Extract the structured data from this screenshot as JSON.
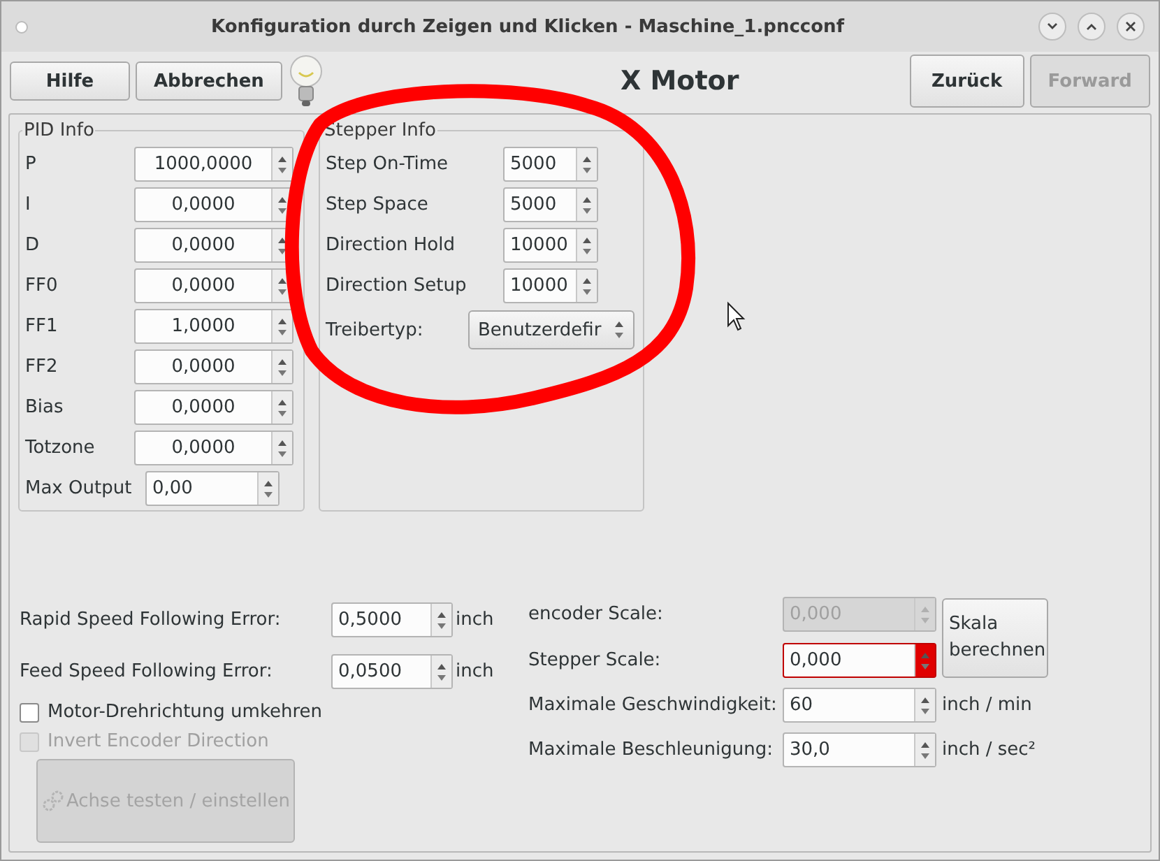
{
  "window": {
    "title": "Konfiguration durch Zeigen und Klicken - Maschine_1.pncconf"
  },
  "toolbar": {
    "buttons": [
      {
        "label": "Hilfe",
        "disabled": false
      },
      {
        "label": "Abbrechen",
        "disabled": false
      }
    ],
    "heading": "X Motor",
    "nav_buttons": [
      {
        "label": "Zurück",
        "disabled": false
      },
      {
        "label": "Forward",
        "disabled": true
      }
    ]
  },
  "pid_info": {
    "title": "PID Info",
    "rows": [
      {
        "label": "P",
        "value": "1000,0000"
      },
      {
        "label": "I",
        "value": "0,0000"
      },
      {
        "label": "D",
        "value": "0,0000"
      },
      {
        "label": "FF0",
        "value": "0,0000"
      },
      {
        "label": "FF1",
        "value": "1,0000"
      },
      {
        "label": "FF2",
        "value": "0,0000"
      },
      {
        "label": "Bias",
        "value": "0,0000"
      },
      {
        "label": "Totzone",
        "value": "0,0000"
      }
    ],
    "max_output": {
      "label": "Max Output",
      "value": "0,00"
    }
  },
  "stepper_info": {
    "title": "Stepper Info",
    "rows": [
      {
        "label": "Step On-Time",
        "value": "5000"
      },
      {
        "label": "Step Space",
        "value": "5000"
      },
      {
        "label": "Direction Hold",
        "value": "10000"
      },
      {
        "label": "Direction Setup",
        "value": "10000"
      }
    ],
    "driver": {
      "label": "Treibertyp:",
      "value": "Benutzerdefir"
    }
  },
  "following_errors": [
    {
      "label": "Rapid Speed Following Error:",
      "value": "0,5000",
      "unit": "inch"
    },
    {
      "label": "Feed Speed Following Error:",
      "value": "0,0500",
      "unit": "inch"
    }
  ],
  "checkboxes": [
    {
      "label": "Motor-Drehrichtung umkehren",
      "checked": false,
      "disabled": false
    },
    {
      "label": "Invert Encoder Direction",
      "checked": false,
      "disabled": true
    }
  ],
  "test_button": {
    "label": "Achse testen / einstellen",
    "disabled": true
  },
  "scales": [
    {
      "label": "encoder Scale:",
      "value": "0,000",
      "disabled": true,
      "error": false
    },
    {
      "label": "Stepper Scale:",
      "value": "0,000",
      "disabled": false,
      "error": true
    }
  ],
  "scale_button": {
    "label": "Skala berechnen"
  },
  "limits": [
    {
      "label": "Maximale Geschwindigkeit:",
      "value": "60",
      "unit": "inch / min"
    },
    {
      "label": "Maximale Beschleunigung:",
      "value": "30,0",
      "unit": "inch / sec²"
    }
  ]
}
